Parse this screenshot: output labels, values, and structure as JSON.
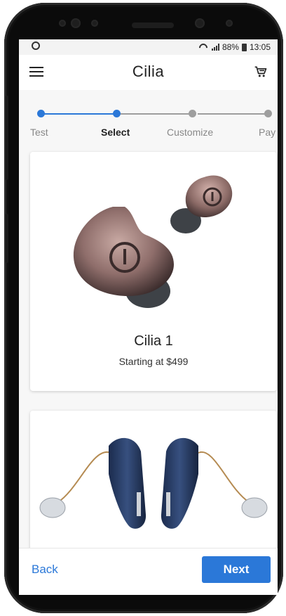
{
  "status": {
    "signal_text": "88%",
    "time": "13:05"
  },
  "appbar": {
    "title": "Cilia",
    "menu_icon": "menu-icon",
    "cart_icon": "cart-icon"
  },
  "stepper": {
    "steps": [
      {
        "label": "Test",
        "state": "complete"
      },
      {
        "label": "Select",
        "state": "active"
      },
      {
        "label": "Customize",
        "state": "inactive"
      },
      {
        "label": "Pay",
        "state": "inactive"
      }
    ],
    "active_color": "#2b78d8",
    "inactive_color": "#9e9e9e"
  },
  "products": [
    {
      "name": "Cilia 1",
      "price": "Starting at $499"
    }
  ],
  "footer": {
    "back_label": "Back",
    "next_label": "Next",
    "accent": "#2b78d8"
  }
}
